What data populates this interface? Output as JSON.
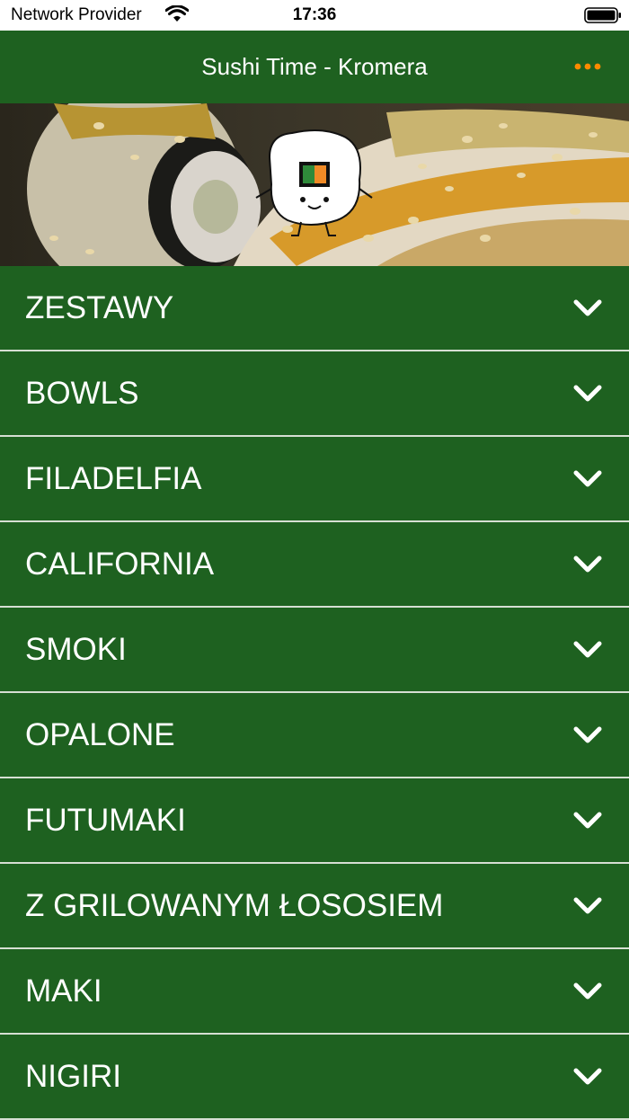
{
  "status_bar": {
    "carrier": "Network Provider",
    "time": "17:36"
  },
  "header": {
    "title": "Sushi Time - Kromera",
    "more_icon": "ellipsis-icon",
    "accent_color": "#ff8a00"
  },
  "hero": {
    "description_icon": "sushi-mascot-icon"
  },
  "menu": {
    "items": [
      {
        "label": "ZESTAWY"
      },
      {
        "label": "BOWLS"
      },
      {
        "label": "FILADELFIA"
      },
      {
        "label": "CALIFORNIA"
      },
      {
        "label": "SMOKI"
      },
      {
        "label": "OPALONE"
      },
      {
        "label": "FUTUMAKI"
      },
      {
        "label": "Z GRILOWANYM ŁOSOSIEM"
      },
      {
        "label": "MAKI"
      },
      {
        "label": "NIGIRI"
      }
    ],
    "chevron_icon": "chevron-down-icon"
  },
  "colors": {
    "primary": "#1e6120",
    "divider": "#d6dfd3",
    "text": "#ffffff"
  }
}
